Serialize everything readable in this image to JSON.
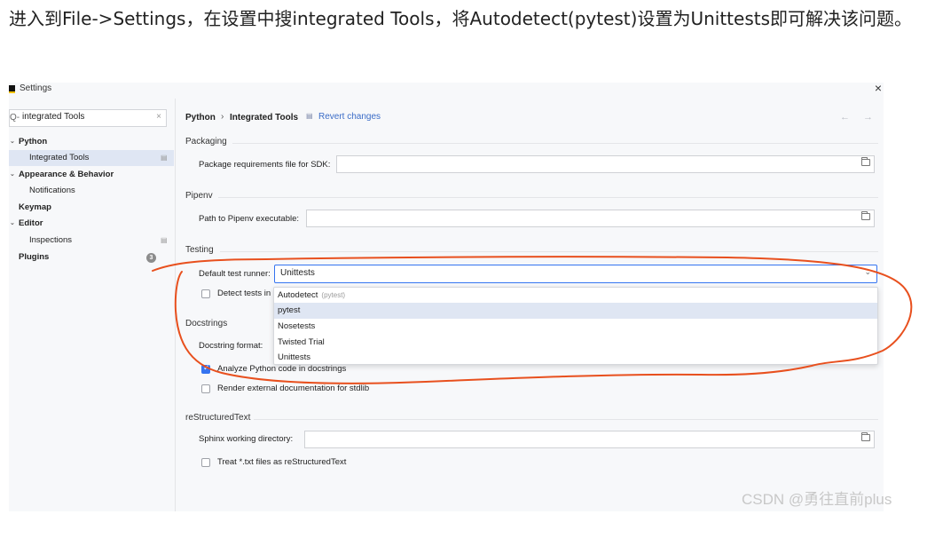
{
  "article": {
    "text": "进入到File->Settings，在设置中搜integrated Tools，将Autodetect(pytest)设置为Unittests即可解决该问题。"
  },
  "window": {
    "title": "Settings",
    "close_glyph": "×"
  },
  "sidebar": {
    "search_value": "integrated Tools",
    "search_icon_glyph": "Q-",
    "clear_glyph": "×",
    "items": [
      {
        "label": "Python"
      },
      {
        "label": "Integrated Tools"
      },
      {
        "label": "Appearance & Behavior"
      },
      {
        "label": "Notifications"
      },
      {
        "label": "Keymap"
      },
      {
        "label": "Editor"
      },
      {
        "label": "Inspections"
      },
      {
        "label": "Plugins",
        "badge": "3"
      }
    ]
  },
  "header": {
    "breadcrumb_parent": "Python",
    "breadcrumb_sep": "›",
    "breadcrumb_page": "Integrated Tools",
    "revert_label": "Revert changes",
    "nav": "← →"
  },
  "packaging": {
    "title": "Packaging",
    "req_label": "Package requirements file for SDK:",
    "req_value": ""
  },
  "pipenv": {
    "title": "Pipenv",
    "path_label": "Path to Pipenv executable:",
    "path_value": ""
  },
  "testing": {
    "title": "Testing",
    "runner_label": "Default test runner:",
    "runner_value": "Unittests",
    "detect_label": "Detect tests in",
    "detect_checked": false,
    "options": [
      {
        "label": "Autodetect",
        "hint": "(pytest)"
      },
      {
        "label": "pytest",
        "highlighted": true
      },
      {
        "label": "Nosetests"
      },
      {
        "label": "Twisted Trial"
      },
      {
        "label": "Unittests"
      }
    ]
  },
  "docstrings": {
    "title": "Docstrings",
    "format_label": "Docstring format:",
    "analyze_label": "Analyze Python code in docstrings",
    "analyze_checked": true,
    "render_label": "Render external documentation for stdlib",
    "render_checked": false
  },
  "rest": {
    "title": "reStructuredText",
    "sphinx_label": "Sphinx working directory:",
    "sphinx_value": "",
    "treat_label": "Treat *.txt files as reStructuredText",
    "treat_checked": false
  },
  "watermark": "CSDN @勇往直前plus",
  "colors": {
    "accent": "#3574f0",
    "annotation_stroke": "#e8501e",
    "selection": "#dfe6f3"
  }
}
